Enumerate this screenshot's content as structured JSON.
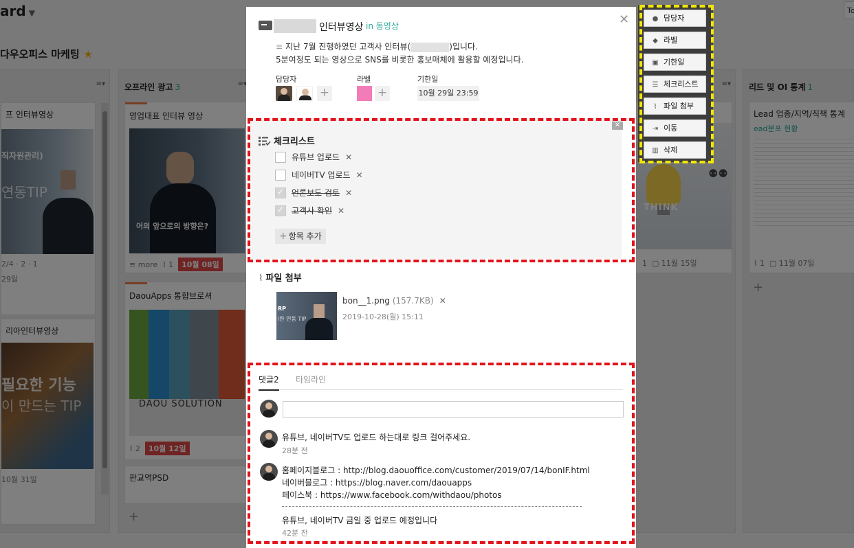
{
  "board": {
    "title": "ard",
    "subtitle": "다우오피스 마케팅",
    "top_button": "To"
  },
  "columns": [
    {
      "name": "",
      "cards": [
        {
          "title": "프 인터뷰영상",
          "meta": "2/4 · 2 · 1",
          "date": "29일"
        },
        {
          "title": "리아인터뷰영상",
          "date": "10월 31일"
        }
      ]
    },
    {
      "name": "오프라인 광고",
      "count": "3",
      "cards": [
        {
          "title": "영업대표 인터뷰 영상",
          "meta_more": "more",
          "meta_attach": "1",
          "date": "10월 08일"
        },
        {
          "title": "DaouApps 통합브로셔",
          "image_text": "DAOU SOLUTION",
          "meta_attach": "2",
          "date": "10월 12일"
        },
        {
          "title": "판교역PSD"
        }
      ]
    },
    {
      "name": "리드 및 OI 통계",
      "count": "1",
      "cards": [
        {
          "title": "Lead 업종/지역/직책 통계",
          "subtitle": "ead분포 현황",
          "meta_attach": "1",
          "date": "11월 07일"
        }
      ]
    },
    {
      "name": "",
      "cards": [
        {
          "thumb_text": "THINK",
          "meta_attach": "1",
          "date": "11월 15일"
        }
      ]
    }
  ],
  "modal": {
    "title": "인터뷰영상",
    "in_label": "in 동영상",
    "description_line1_pre": "지난 7월 진행하였던 고객사 인터뷰(",
    "description_line1_post": ")입니다.",
    "description_line2": "5분여정도 되는 영상으로 SNS를 비롯한 홍보매체에 활용할 예정입니다.",
    "assignee_label": "담당자",
    "label_label": "라벨",
    "due_label": "기한일",
    "due_value": "10월 29일 23:59",
    "label_color": "#f27cb7",
    "checklist": {
      "title": "체크리스트",
      "items": [
        {
          "text": "유튜브 업로드",
          "done": false
        },
        {
          "text": "네이버TV 업로드",
          "done": false
        },
        {
          "text": "언론보도 검토",
          "done": true
        },
        {
          "text": "고객사 확인",
          "done": true
        }
      ],
      "add_label": "항목 추가"
    },
    "attachment": {
      "title": "파일 첨부",
      "file_name": "bon__1.png",
      "file_size": "(157.7KB)",
      "file_date": "2019-10-28(월) 15:11"
    },
    "tabs": {
      "comments": "댓글2",
      "timeline": "타임라인"
    },
    "comments": [
      {
        "text": "유튜브, 네이버TV도 업로드 하는대로 링크 걸어주세요.",
        "time": "28분 전"
      },
      {
        "line1": "홈페이지블로그 : http://blog.daouoffice.com/customer/2019/07/14/bonIF.html",
        "line2": "네이버블로그 : https://blog.naver.com/daouapps",
        "line3": "페이스북 : https://www.facebook.com/withdaou/photos",
        "line4": "유튜브, 네이버TV 금일 중 업로드 예정입니다",
        "time": "42분 전"
      }
    ]
  },
  "side_menu": [
    {
      "label": "담당자",
      "icon": "person-icon"
    },
    {
      "label": "라벨",
      "icon": "tag-icon"
    },
    {
      "label": "기한일",
      "icon": "calendar-icon"
    },
    {
      "label": "체크리스트",
      "icon": "checklist-icon"
    },
    {
      "label": "파일 첨부",
      "icon": "paperclip-icon"
    },
    {
      "label": "이동",
      "icon": "move-icon"
    },
    {
      "label": "삭제",
      "icon": "trash-icon"
    }
  ],
  "colors": {
    "highlight_red": "#e3131b",
    "highlight_yellow": "#f1e700",
    "accent_teal": "#2aa89b",
    "date_red": "#e04646"
  }
}
